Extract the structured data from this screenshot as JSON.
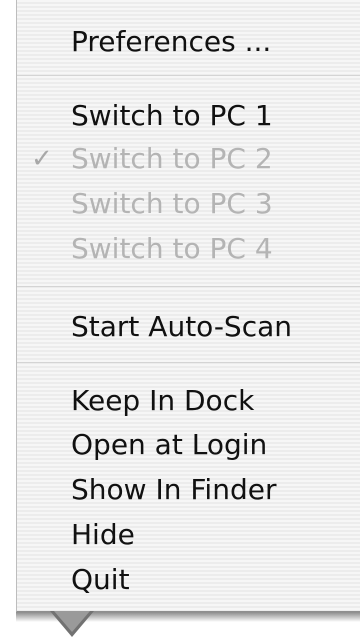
{
  "menu": {
    "preferences": "Preferences ...",
    "switch_pc1": "Switch to PC 1",
    "switch_pc2": "Switch to PC 2",
    "switch_pc3": "Switch to PC 3",
    "switch_pc4": "Switch to PC 4",
    "checkmark": "✓",
    "start_autoscan": "Start Auto-Scan",
    "keep_in_dock": "Keep In Dock",
    "open_at_login": "Open at Login",
    "show_in_finder": "Show In Finder",
    "hide": "Hide",
    "quit": "Quit"
  }
}
